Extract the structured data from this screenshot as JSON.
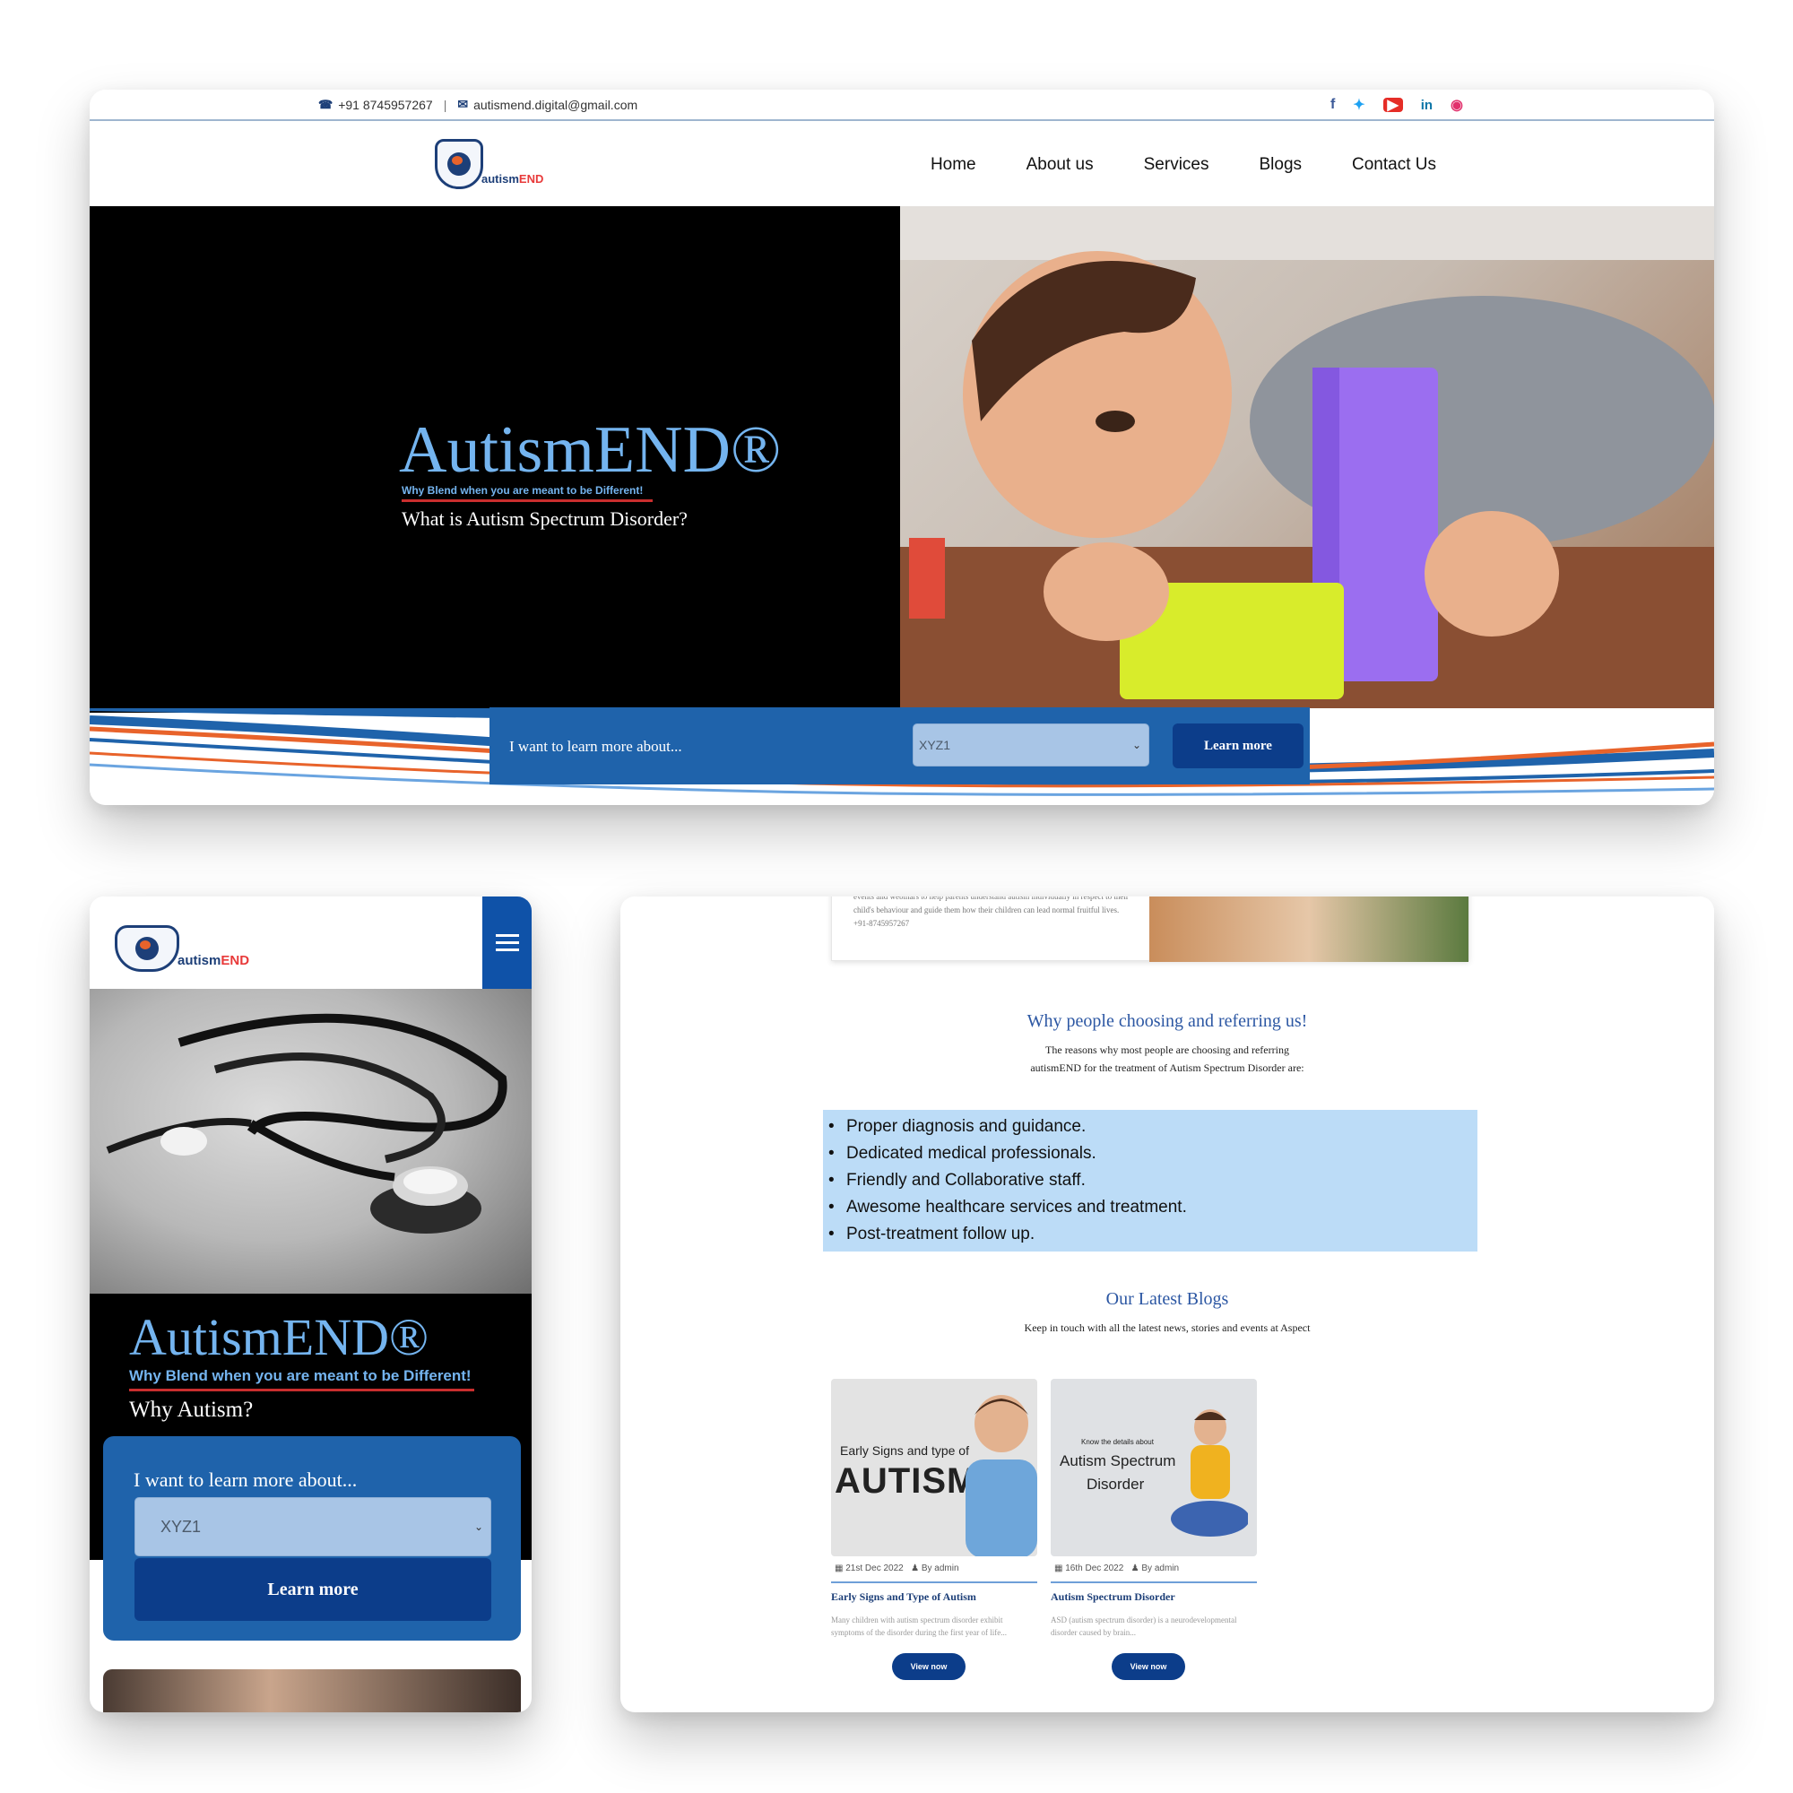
{
  "colors": {
    "accent": "#1f63ab",
    "dark_button": "#0c3d8a",
    "brand_blue": "#74b4ef",
    "brand_red": "#c92e2e",
    "highlight": "#bcdcf7"
  },
  "topbar": {
    "phone": "+91 8745957267",
    "email": "autismend.digital@gmail.com",
    "socials": [
      "facebook-icon",
      "twitter-icon",
      "youtube-icon",
      "linkedin-icon",
      "instagram-icon"
    ]
  },
  "logo": {
    "part1": "autism",
    "part2": "END"
  },
  "nav": {
    "items": [
      "Home",
      "About us",
      "Services",
      "Blogs",
      "Contact Us"
    ]
  },
  "hero": {
    "title": "AutismEND®",
    "tagline": "Why Blend when you are meant to be Different!",
    "question": "What is Autism Spectrum Disorder?",
    "learn_label": "I want to learn more about...",
    "select_value": "XYZ1",
    "button": "Learn more"
  },
  "mobile": {
    "title": "AutismEND®",
    "tagline": "Why Blend when you are meant to be Different!",
    "question": "Why Autism?",
    "learn_label": "I want to learn more about...",
    "select_value": "XYZ1",
    "button": "Learn more"
  },
  "content": {
    "prev_text": "events and webinars to help parents understand autism individually in respect to their child's behaviour and guide them how their children can lead normal fruitful lives. +91-8745957267",
    "why_title": "Why people choosing and referring us!",
    "why_sub_1": "The reasons why most people are choosing and referring",
    "why_sub_2": "autismEND for the treatment of Autism Spectrum Disorder are:",
    "reasons": [
      "Proper diagnosis and guidance.",
      "Dedicated medical professionals.",
      "Friendly and Collaborative staff.",
      "Awesome healthcare services and treatment.",
      "Post-treatment follow up."
    ],
    "blogs_title": "Our Latest Blogs",
    "blogs_sub": "Keep in touch with all the latest news, stories and events at Aspect",
    "blogs": [
      {
        "thumb_line1": "Early Signs and type of",
        "thumb_line2": "AUTISM",
        "date": "21st Dec 2022",
        "author": "By admin",
        "title": "Early Signs and Type of Autism",
        "desc": "Many children with autism spectrum disorder exhibit symptoms of the disorder during the first year of life...",
        "button": "View now"
      },
      {
        "thumb_line0": "Know the details about",
        "thumb_line1": "Autism Spectrum",
        "thumb_line2": "Disorder",
        "date": "16th Dec 2022",
        "author": "By admin",
        "title": "Autism Spectrum Disorder",
        "desc": "ASD (autism spectrum disorder) is a neurodevelopmental disorder caused by brain...",
        "button": "View now"
      }
    ]
  }
}
